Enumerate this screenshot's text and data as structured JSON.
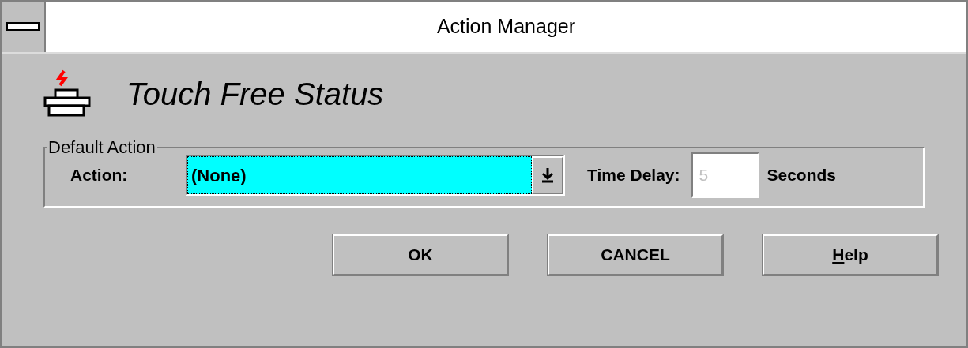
{
  "window": {
    "title": "Action Manager"
  },
  "header": {
    "title": "Touch Free Status"
  },
  "default_action": {
    "legend": "Default Action",
    "action_label": "Action:",
    "action_value": "(None)",
    "action_focused": true,
    "delay_label": "Time Delay:",
    "delay_value": "5",
    "delay_disabled": true,
    "delay_unit": "Seconds"
  },
  "buttons": [
    {
      "label": "OK"
    },
    {
      "label": "CANCEL"
    },
    {
      "mnemonic": "H",
      "label": "elp"
    }
  ]
}
